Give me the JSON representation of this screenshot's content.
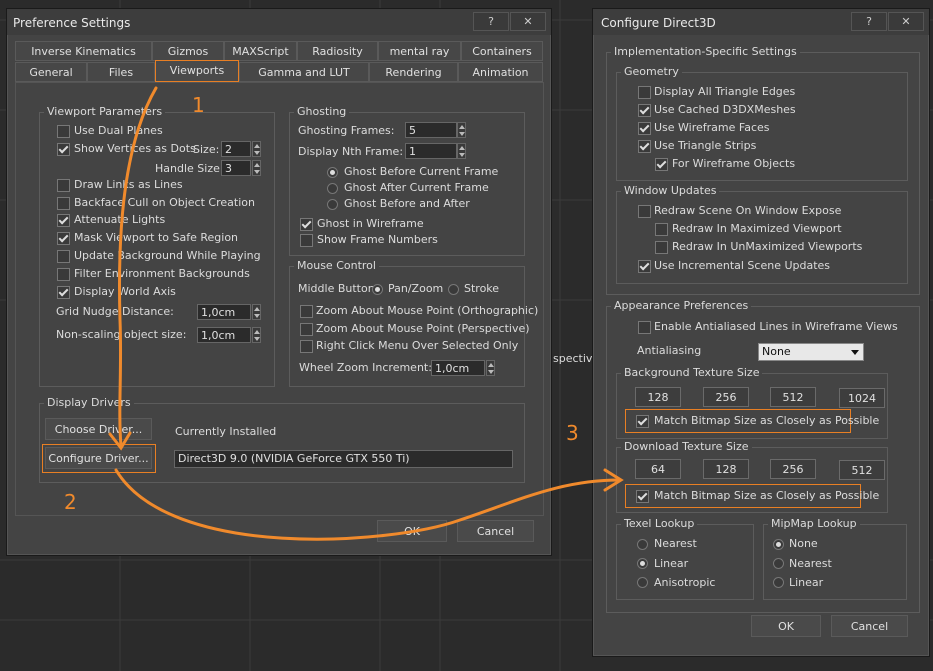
{
  "background": {
    "viewport_text": "spective"
  },
  "pref": {
    "title": "Preference Settings",
    "help_btn": "?",
    "close_btn": "✕",
    "tabs_row1": [
      "Inverse Kinematics",
      "Gizmos",
      "MAXScript",
      "Radiosity",
      "mental ray",
      "Containers"
    ],
    "tabs_row2": [
      "General",
      "Files",
      "Viewports",
      "Gamma and LUT",
      "Rendering",
      "Animation"
    ],
    "viewport_params": {
      "label": "Viewport Parameters",
      "dual_planes": "Use Dual Planes",
      "show_vertices": "Show Vertices as Dots",
      "size_label": "Size:",
      "size_value": "2",
      "handle_size_label": "Handle Size:",
      "handle_size_value": "3",
      "draw_links": "Draw Links as Lines",
      "backface": "Backface Cull on Object Creation",
      "attenuate": "Attenuate Lights",
      "mask_viewport": "Mask Viewport to Safe Region",
      "update_bg": "Update Background While Playing",
      "filter_env": "Filter Environment Backgrounds",
      "display_world": "Display World Axis",
      "grid_nudge_label": "Grid Nudge Distance:",
      "grid_nudge_value": "1,0cm",
      "nonscaling_label": "Non-scaling object size:",
      "nonscaling_value": "1,0cm"
    },
    "ghosting": {
      "label": "Ghosting",
      "frames_label": "Ghosting Frames:",
      "frames_value": "5",
      "nth_label": "Display Nth Frame:",
      "nth_value": "1",
      "before": "Ghost Before Current Frame",
      "after": "Ghost After Current Frame",
      "both": "Ghost Before and After",
      "wireframe": "Ghost in Wireframe",
      "frame_numbers": "Show Frame Numbers"
    },
    "mouse": {
      "label": "Mouse Control",
      "middle_label": "Middle Button:",
      "pan_zoom": "Pan/Zoom",
      "stroke": "Stroke",
      "zoom_ortho": "Zoom About Mouse Point (Orthographic)",
      "zoom_persp": "Zoom About Mouse Point (Perspective)",
      "right_click": "Right Click Menu Over Selected Only",
      "wheel_label": "Wheel Zoom Increment:",
      "wheel_value": "1,0cm"
    },
    "drivers": {
      "label": "Display Drivers",
      "choose": "Choose Driver...",
      "configure": "Configure Driver...",
      "installed_label": "Currently Installed",
      "installed_value": "Direct3D 9.0 (NVIDIA GeForce GTX 550 Ti)"
    },
    "ok": "OK",
    "cancel": "Cancel"
  },
  "d3d": {
    "title": "Configure Direct3D",
    "help_btn": "?",
    "close_btn": "✕",
    "impl_label": "Implementation-Specific Settings",
    "geometry": {
      "label": "Geometry",
      "display_all": "Display All Triangle Edges",
      "cached": "Use Cached D3DXMeshes",
      "wireframe_faces": "Use Wireframe Faces",
      "triangle_strips": "Use Triangle Strips",
      "for_wireframe": "For Wireframe Objects"
    },
    "window_updates": {
      "label": "Window Updates",
      "redraw_expose": "Redraw Scene On Window Expose",
      "redraw_max": "Redraw In Maximized Viewport",
      "redraw_unmax": "Redraw In UnMaximized Viewports",
      "incremental": "Use Incremental Scene Updates"
    },
    "appearance": {
      "label": "Appearance Preferences",
      "antialiased": "Enable Antialiased Lines in Wireframe Views",
      "aa_label": "Antialiasing",
      "aa_value": "None",
      "bg_label": "Background Texture Size",
      "bg_sizes": [
        "128",
        "256",
        "512",
        "1024"
      ],
      "bg_match": "Match Bitmap Size as Closely as Possible",
      "dl_label": "Download Texture Size",
      "dl_sizes": [
        "64",
        "128",
        "256",
        "512"
      ],
      "dl_match": "Match Bitmap Size as Closely as Possible",
      "texel_label": "Texel Lookup",
      "texel": [
        "Nearest",
        "Linear",
        "Anisotropic"
      ],
      "mip_label": "MipMap Lookup",
      "mip": [
        "None",
        "Nearest",
        "Linear"
      ]
    },
    "ok": "OK",
    "cancel": "Cancel"
  },
  "annotations": {
    "n1": "1",
    "n2": "2",
    "n3": "3",
    "color": "#f08a2c"
  }
}
